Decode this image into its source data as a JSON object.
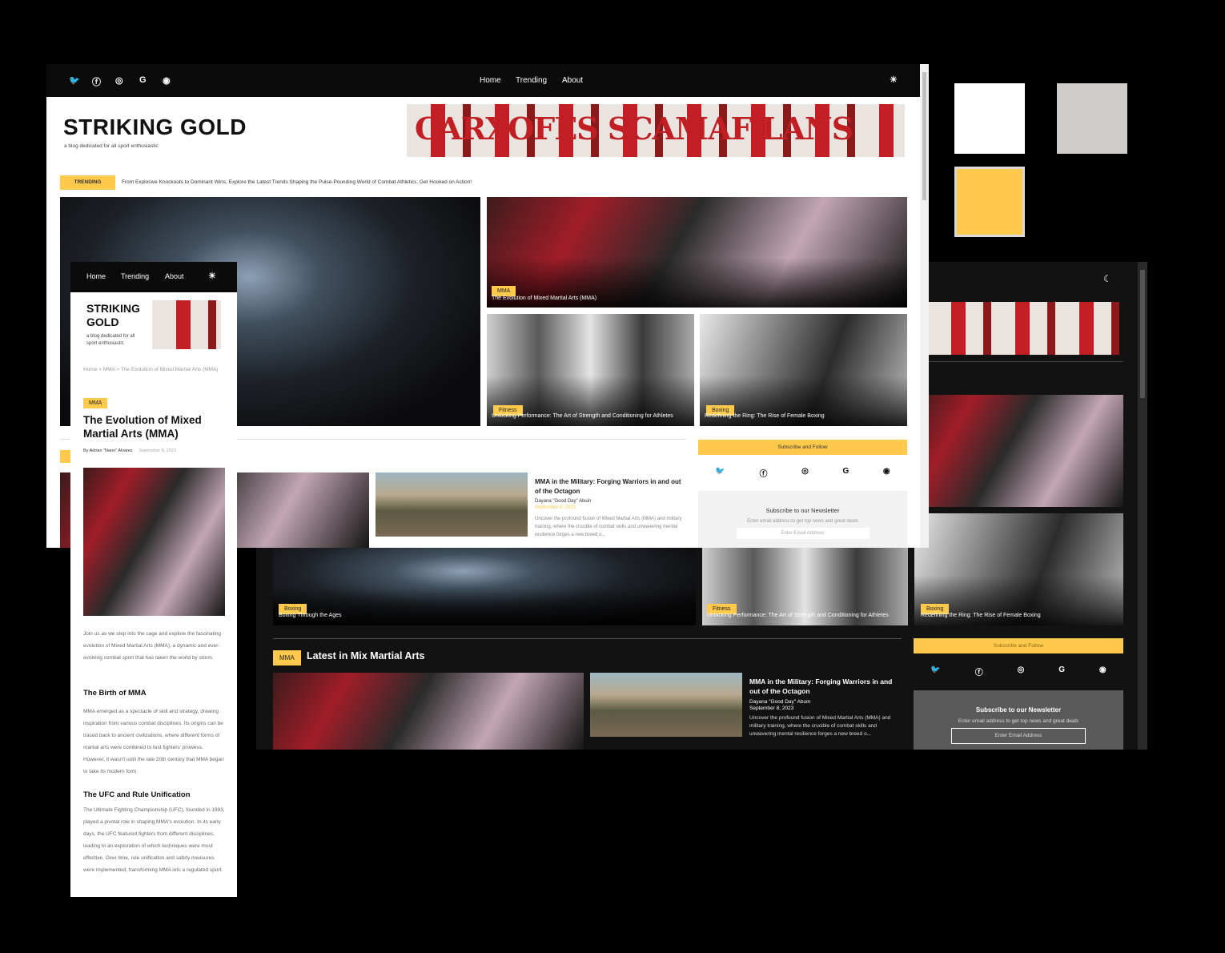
{
  "swatch_colors": [
    "#ffffff",
    "#cfcccc",
    "#ffc94b"
  ],
  "brand": {
    "title": "STRIKING GOLD",
    "tagline": "a blog dedicated for all sport enthusiastic",
    "accent": "#ffc94b",
    "banner_text": "CARXOFES SCAMAF LANS"
  },
  "nav": {
    "social_icons": [
      "twitter-icon",
      "facebook-icon",
      "instagram-icon",
      "google-icon",
      "discord-icon"
    ],
    "links": [
      "Home",
      "Trending",
      "About"
    ]
  },
  "trending": {
    "label": "TRENDING",
    "text": "From Explosive Knockouts to Dominant Wins, Explore the Latest Trends Shaping the Pulse-Pounding World of Combat Athletics. Get Hooked on Action!"
  },
  "cards": {
    "mma": {
      "tag": "MMA",
      "title": "The Evolution of Mixed Martial Arts (MMA)"
    },
    "fitness": {
      "tag": "Fitness",
      "title": "Unlocking Performance: The Art of Strength and Conditioning for Athletes"
    },
    "boxing": {
      "tag": "Boxing",
      "title": "Redefining the Ring: The Rise of Female Boxing"
    },
    "boxing_ages": {
      "tag": "Boxing",
      "title": "Boxing Through the Ages"
    }
  },
  "article_military": {
    "title": "MMA in the Military: Forging Warriors in and out of the Octagon",
    "author": "Dayana \"Good Day\" Abuin",
    "date": "September 8, 2023",
    "excerpt": "Uncover the profound fusion of Mixed Martial Arts (MMA) and military training, where the crucible of combat skills and unwavering mental resilience forges a new breed o..."
  },
  "sidebar": {
    "follow_label": "Subscribe and Follow",
    "newsletter_title": "Subscribe to our Newsletter",
    "newsletter_text": "Enter email address to get top news and great deals",
    "email_placeholder": "Enter Email Address"
  },
  "dark_section": {
    "tag": "MMA",
    "heading": "Latest in Mix Martial Arts"
  },
  "mobile": {
    "breadcrumb": "Home > MMA > The Evolution of Mixed Martial Arts (MMA)",
    "tag": "MMA",
    "title": "The Evolution of Mixed Martial Arts (MMA)",
    "byline": "By Adrian \"Nano\" Alvarez",
    "date": "September 8, 2023",
    "intro": "Join us as we step into the cage and explore the fascinating evolution of Mixed Martial Arts (MMA), a dynamic and ever-evolving combat sport that has taken the world by storm.",
    "h1": "The Birth of MMA",
    "p1": "MMA emerged as a spectacle of skill and strategy, drawing inspiration from various combat disciplines. Its origins can be traced back to ancient civilizations, where different forms of martial arts were combined to test fighters' prowess. However, it wasn't until the late 20th century that MMA began to take its modern form.",
    "h2": "The UFC and Rule Unification",
    "p2": "The Ultimate Fighting Championship (UFC), founded in 1993, played a pivotal role in shaping MMA's evolution. In its early days, the UFC featured fighters from different disciplines, leading to an exploration of which techniques were most effective. Over time, rule unification and safety measures were implemented, transforming MMA into a regulated sport."
  }
}
